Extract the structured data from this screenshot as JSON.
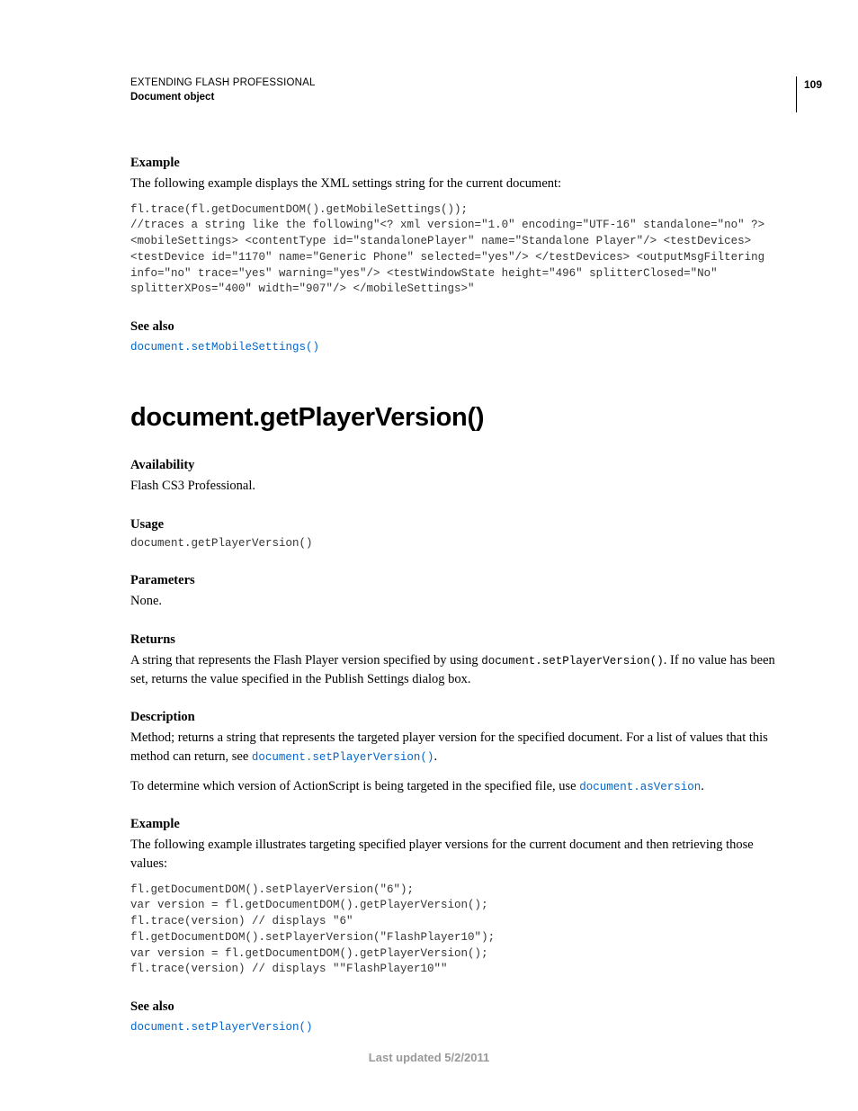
{
  "header": {
    "title": "EXTENDING FLASH PROFESSIONAL",
    "subtitle": "Document object",
    "page_number": "109"
  },
  "example1": {
    "label": "Example",
    "intro": "The following example displays the XML settings string for the current document:",
    "code": "fl.trace(fl.getDocumentDOM().getMobileSettings());\n//traces a string like the following\"<? xml version=\"1.0\" encoding=\"UTF-16\" standalone=\"no\" ?><mobileSettings> <contentType id=\"standalonePlayer\" name=\"Standalone Player\"/> <testDevices> <testDevice id=\"1170\" name=\"Generic Phone\" selected=\"yes\"/> </testDevices> <outputMsgFiltering info=\"no\" trace=\"yes\" warning=\"yes\"/> <testWindowState height=\"496\" splitterClosed=\"No\" splitterXPos=\"400\" width=\"907\"/> </mobileSettings>\""
  },
  "seealso1": {
    "label": "See also",
    "link": "document.setMobileSettings()"
  },
  "main": {
    "heading": "document.getPlayerVersion()"
  },
  "availability": {
    "label": "Availability",
    "text": "Flash CS3 Professional."
  },
  "usage": {
    "label": "Usage",
    "code": "document.getPlayerVersion()"
  },
  "parameters": {
    "label": "Parameters",
    "text": "None."
  },
  "returns": {
    "label": "Returns",
    "text_before": "A string that represents the Flash Player version specified by using ",
    "inline_code": "document.setPlayerVersion()",
    "text_after": ". If no value has been set, returns the value specified in the Publish Settings dialog box."
  },
  "description": {
    "label": "Description",
    "p1_before": "Method; returns a string that represents the targeted player version for the specified document. For a list of values that this method can return, see ",
    "p1_link": "document.setPlayerVersion()",
    "p1_after": ".",
    "p2_before": "To determine which version of ActionScript is being targeted in the specified file, use ",
    "p2_link": "document.asVersion",
    "p2_after": "."
  },
  "example2": {
    "label": "Example",
    "intro": "The following example illustrates targeting specified player versions for the current document and then retrieving those values:",
    "code": "fl.getDocumentDOM().setPlayerVersion(\"6\");\nvar version = fl.getDocumentDOM().getPlayerVersion();\nfl.trace(version) // displays \"6\"\nfl.getDocumentDOM().setPlayerVersion(\"FlashPlayer10\");\nvar version = fl.getDocumentDOM().getPlayerVersion();\nfl.trace(version) // displays \"\"FlashPlayer10\"\""
  },
  "seealso2": {
    "label": "See also",
    "link": "document.setPlayerVersion()"
  },
  "footer": {
    "text": "Last updated 5/2/2011"
  }
}
